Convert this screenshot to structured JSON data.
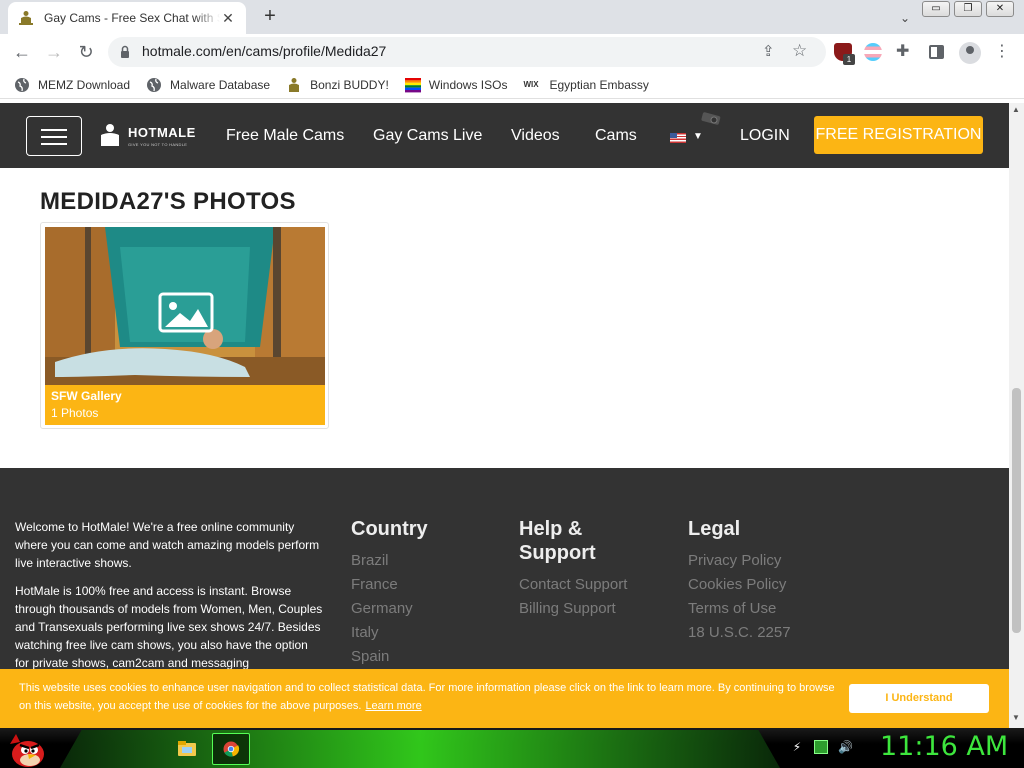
{
  "browser": {
    "tab_title": "Gay Cams - Free Sex Chat with Su",
    "tab_close": "✕",
    "new_tab": "+",
    "url": "hotmale.com/en/cams/profile/Medida27",
    "extension_badge": "1",
    "window_buttons": [
      "▭",
      "❐",
      "✕"
    ],
    "bookmarks": [
      {
        "label": "MEMZ Download",
        "icon": "globe-icon"
      },
      {
        "label": "Malware Database",
        "icon": "globe-icon"
      },
      {
        "label": "Bonzi BUDDY!",
        "icon": "hotmale-icon"
      },
      {
        "label": "Windows ISOs",
        "icon": "windows-logo-icon"
      },
      {
        "label": "Egyptian Embassy",
        "icon": "wix-icon"
      }
    ],
    "wix_text": "WIX"
  },
  "header": {
    "logo_text": "HOTMALE",
    "logo_tagline": "GIVE YOU NOT TO HANDLE",
    "nav": [
      "Free Male Cams",
      "Gay Cams Live",
      "Videos",
      "Cams"
    ],
    "login": "LOGIN",
    "register": "FREE REGISTRATION"
  },
  "main": {
    "section_title": "MEDIDA27'S PHOTOS",
    "gallery": {
      "title": "SFW Gallery",
      "count": "1 Photos"
    }
  },
  "footer": {
    "about": [
      "Welcome to HotMale! We're a free online community where you can come and watch amazing models perform live interactive shows.",
      "HotMale is 100% free and access is instant. Browse through thousands of models from Women, Men, Couples and Transexuals performing live sex shows 24/7. Besides watching free live cam shows, you also have the option for private shows, cam2cam and messaging"
    ],
    "columns": [
      {
        "title": "Country",
        "links": [
          "Brazil",
          "France",
          "Germany",
          "Italy",
          "Spain"
        ]
      },
      {
        "title": "Help & Support",
        "links": [
          "Contact Support",
          "Billing Support"
        ]
      },
      {
        "title": "Legal",
        "links": [
          "Privacy Policy",
          "Cookies Policy",
          "Terms of Use",
          "18 U.S.C. 2257"
        ]
      }
    ]
  },
  "cookie": {
    "text": "This website uses cookies to enhance user navigation and to collect statistical data. For more information please click on the link to learn more. By continuing to browse on this website, you accept the use of cookies for the above purposes.",
    "learn_more": "Learn more",
    "button": "I Understand"
  },
  "taskbar": {
    "clock": "11:16 AM"
  },
  "colors": {
    "accent": "#fcb514",
    "header_bg": "#333333",
    "clock": "#3de63d"
  }
}
